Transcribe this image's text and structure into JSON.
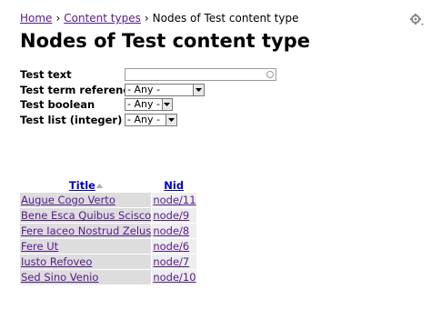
{
  "breadcrumb": {
    "home": "Home",
    "content_types": "Content types",
    "separator": "›",
    "current": "Nodes of Test content type"
  },
  "page_title": "Nodes of Test content type",
  "filters": {
    "test_text": {
      "label": "Test text",
      "value": ""
    },
    "term_reference": {
      "label": "Test term reference",
      "selected": "- Any -"
    },
    "boolean": {
      "label": "Test boolean",
      "selected": "- Any -"
    },
    "list_integer": {
      "label": "Test list (integer)",
      "selected": "- Any -"
    }
  },
  "table": {
    "headers": {
      "title": "Title",
      "nid": "Nid"
    },
    "rows": [
      {
        "title": "Augue Cogo Verto",
        "nid": "node/11"
      },
      {
        "title": "Bene Esca Quibus Scisco",
        "nid": "node/9"
      },
      {
        "title": "Fere Iaceo Nostrud Zelus",
        "nid": "node/8"
      },
      {
        "title": "Fere Ut",
        "nid": "node/6"
      },
      {
        "title": "Iusto Refoveo",
        "nid": "node/7"
      },
      {
        "title": "Sed Sino Venio",
        "nid": "node/10"
      }
    ]
  },
  "icons": {
    "gear": "gear-icon",
    "sort": "sort-ascending-icon",
    "dropdown": "chevron-down-icon"
  },
  "colors": {
    "link": "#551a8b",
    "row_title_bg": "#dddddd",
    "row_nid_bg": "#eeeeee"
  }
}
